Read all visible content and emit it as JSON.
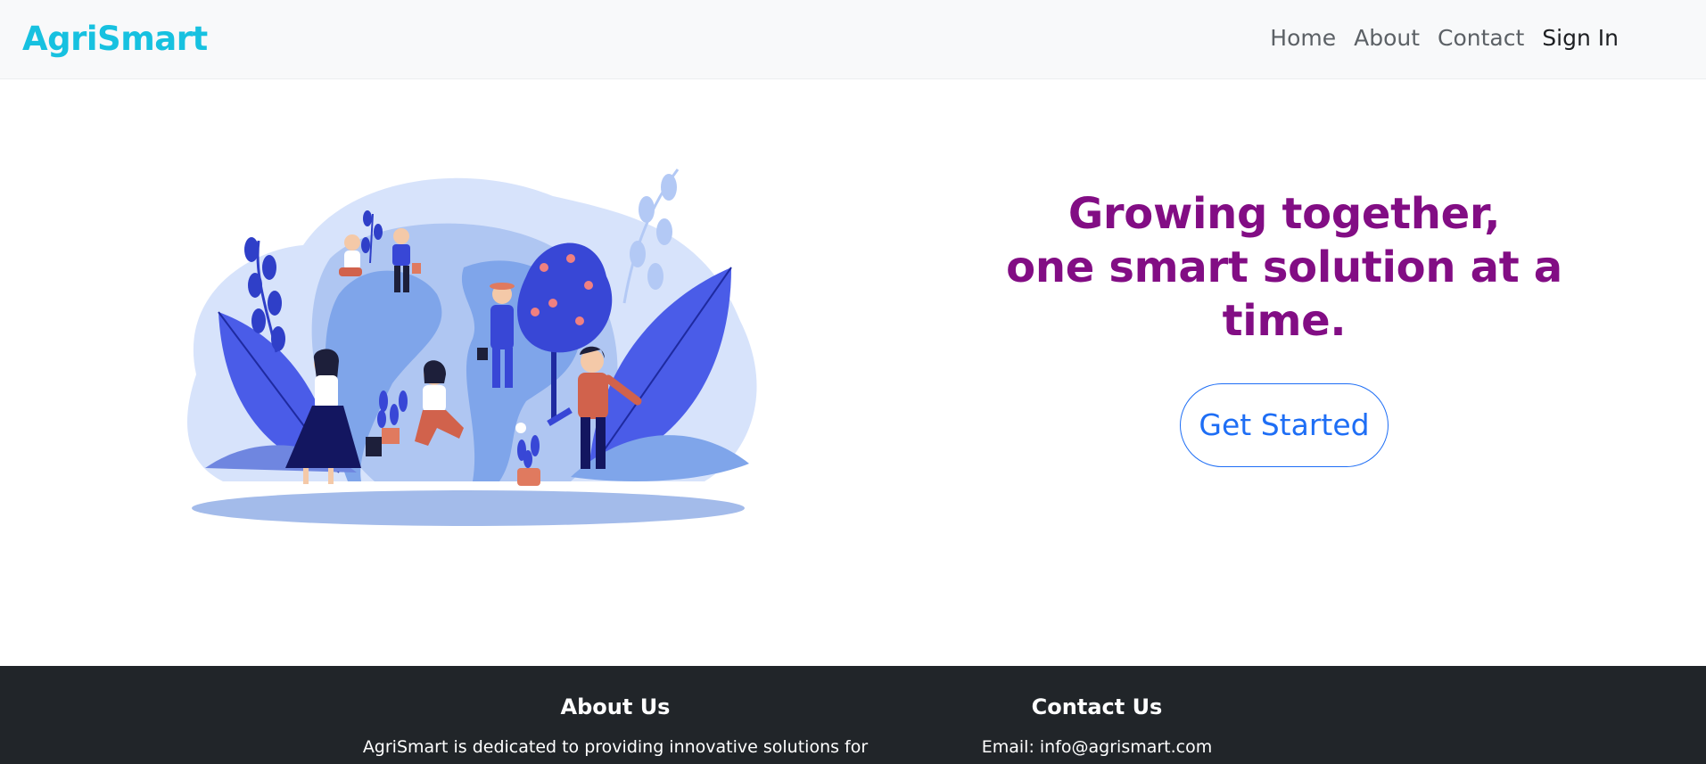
{
  "brand": {
    "name": "AgriSmart",
    "color": "#17c1e0"
  },
  "nav": {
    "items": [
      {
        "label": "Home"
      },
      {
        "label": "About"
      },
      {
        "label": "Contact"
      },
      {
        "label": "Sign In"
      }
    ]
  },
  "hero": {
    "headline_line1": "Growing together,",
    "headline_line2": "one smart solution at a time.",
    "cta_label": "Get Started",
    "headline_color": "#820d84",
    "cta_color": "#1e6ef5"
  },
  "footer": {
    "about_title": "About Us",
    "about_text": "AgriSmart is dedicated to providing innovative solutions for",
    "contact_title": "Contact Us",
    "contact_email": "Email: info@agrismart.com",
    "background": "#212529"
  }
}
